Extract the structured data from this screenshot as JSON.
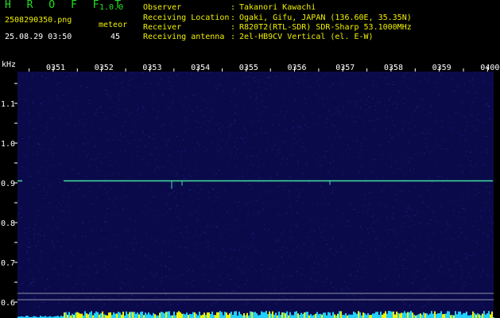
{
  "header": {
    "app_title": "H R O F F T",
    "app_version": "1.0.0",
    "file_name": "2508290350.png",
    "meteor_label": "meteor",
    "datetime": "25.08.29 03:50",
    "meteor_count": "45",
    "info": [
      {
        "label": "Observer",
        "value": "Takanori Kawachi"
      },
      {
        "label": "Receiving Location",
        "value": "Ogaki, Gifu, JAPAN (136.60E, 35.35N)"
      },
      {
        "label": "Receiver",
        "value": "R820T2(RTL-SDR) SDR-Sharp 53.1000MHz"
      },
      {
        "label": "Receiving antenna",
        "value": "2el-HB9CV Vertical (el. E-W)"
      }
    ]
  },
  "spectrogram": {
    "y_unit": "kHz",
    "time_labels": [
      "0351",
      "0352",
      "0353",
      "0354",
      "0355",
      "0356",
      "0357",
      "0358",
      "0359",
      "0400"
    ],
    "freq_labels": [
      "1.1",
      "1.0",
      "0.9",
      "0.8",
      "0.7",
      "0.6"
    ],
    "freq_values": [
      1.1,
      1.0,
      0.9,
      0.8,
      0.7,
      0.6
    ],
    "carrier_freq_khz": 0.905,
    "colors": {
      "background": "#0a0a4a",
      "noise": "#3030c0",
      "carrier": "#40e0a0",
      "guide_line": "#c0c0c0",
      "activity_cyan": "#20d0ff",
      "activity_yellow": "#f0f000"
    }
  }
}
